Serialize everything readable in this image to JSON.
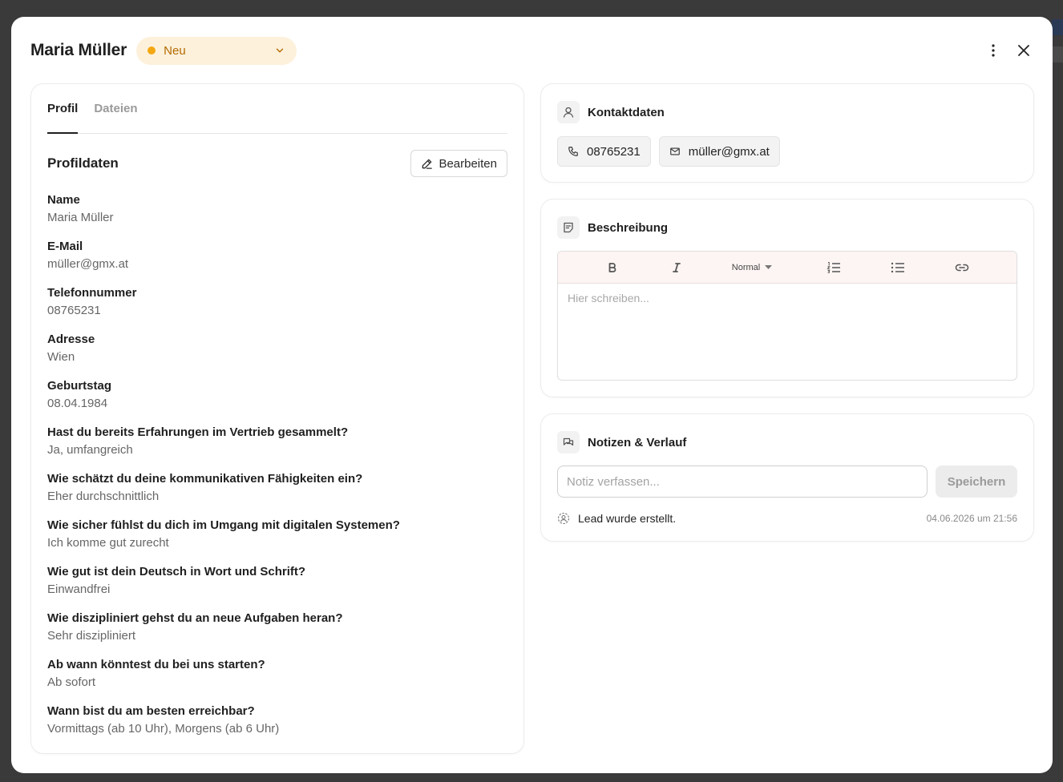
{
  "header": {
    "title": "Maria Müller",
    "status": {
      "label": "Neu",
      "color": "#f3a712"
    }
  },
  "tabs": [
    {
      "label": "Profil",
      "active": true
    },
    {
      "label": "Dateien",
      "active": false
    }
  ],
  "profile": {
    "title": "Profildaten",
    "edit_label": "Bearbeiten",
    "fields": [
      {
        "label": "Name",
        "value": "Maria Müller"
      },
      {
        "label": "E-Mail",
        "value": "müller@gmx.at"
      },
      {
        "label": "Telefonnummer",
        "value": "08765231"
      },
      {
        "label": "Adresse",
        "value": "Wien"
      },
      {
        "label": "Geburtstag",
        "value": "08.04.1984"
      },
      {
        "label": "Hast du bereits Erfahrungen im Vertrieb gesammelt?",
        "value": "Ja, umfangreich"
      },
      {
        "label": "Wie schätzt du deine kommunikativen Fähigkeiten ein?",
        "value": "Eher durchschnittlich"
      },
      {
        "label": "Wie sicher fühlst du dich im Umgang mit digitalen Systemen?",
        "value": "Ich komme gut zurecht"
      },
      {
        "label": "Wie gut ist dein Deutsch in Wort und Schrift?",
        "value": "Einwandfrei"
      },
      {
        "label": "Wie diszipliniert gehst du an neue Aufgaben heran?",
        "value": "Sehr diszipliniert"
      },
      {
        "label": "Ab wann könntest du bei uns starten?",
        "value": "Ab sofort"
      },
      {
        "label": "Wann bist du am besten erreichbar?",
        "value": "Vormittags (ab 10 Uhr), Morgens (ab 6 Uhr)"
      }
    ]
  },
  "contact": {
    "title": "Kontaktdaten",
    "phone": "08765231",
    "email": "müller@gmx.at"
  },
  "description": {
    "title": "Beschreibung",
    "format_label": "Normal",
    "placeholder": "Hier schreiben..."
  },
  "notes": {
    "title": "Notizen & Verlauf",
    "placeholder": "Notiz verfassen...",
    "save_label": "Speichern",
    "history": [
      {
        "text": "Lead wurde erstellt.",
        "time": "04.06.2026 um 21:56"
      }
    ]
  }
}
